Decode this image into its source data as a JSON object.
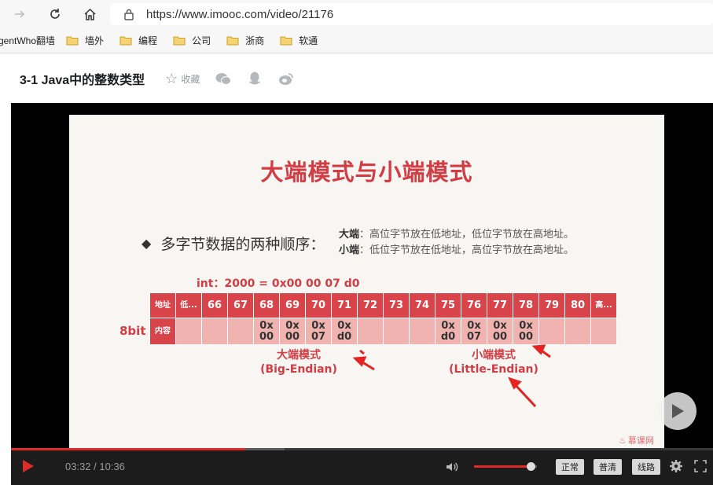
{
  "browser": {
    "url": "https://www.imooc.com/video/21176",
    "bookmarks": [
      "gentWho翻墙",
      "墙外",
      "编程",
      "公司",
      "浙商",
      "软通"
    ]
  },
  "header": {
    "title": "3-1 Java中的整数类型",
    "favorite_label": "收藏",
    "share_icons": [
      "wechat-icon",
      "qq-icon",
      "weibo-icon"
    ]
  },
  "slide": {
    "title": "大端模式与小端模式",
    "bullet": "多字节数据的两种顺序：",
    "big_endian_term": "大端",
    "big_endian_desc": "：高位字节放在低地址，低位字节放在高地址。",
    "little_endian_term": "小端",
    "little_endian_desc": "：低位字节放在低地址，高位字节放在高地址。",
    "int_label": "int：2000 = 0x00 00 07 d0",
    "bit_label": "8bit",
    "addr_header": "地址",
    "content_header": "内容",
    "addresses": [
      "低...",
      "66",
      "67",
      "68",
      "69",
      "70",
      "71",
      "72",
      "73",
      "74",
      "75",
      "76",
      "77",
      "78",
      "79",
      "80",
      "高..."
    ],
    "contents": [
      "",
      "",
      "",
      "0x 00",
      "0x 00",
      "0x 07",
      "0x d0",
      "",
      "",
      "",
      "0x d0",
      "0x 07",
      "0x 00",
      "0x 00",
      "",
      "",
      ""
    ],
    "big_endian_label": "大端模式",
    "big_endian_label_en": "(Big-Endian)",
    "little_endian_label": "小端模式",
    "little_endian_label_en": "(Little-Endian)",
    "watermark": "慕课网",
    "accent_color": "#d43c44"
  },
  "player": {
    "current_time": "03:32",
    "duration": "10:36",
    "time_display": "03:32 / 10:36",
    "progress_fraction": 0.3333,
    "volume_fraction": 0.9,
    "quality_buttons": [
      "正常",
      "普清",
      "线路"
    ]
  }
}
